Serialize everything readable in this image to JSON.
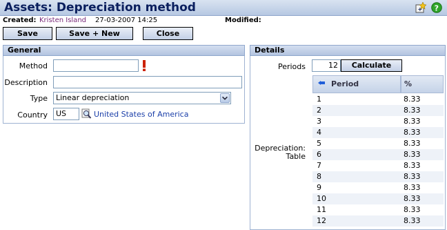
{
  "header": {
    "title": "Assets: Depreciation method"
  },
  "info": {
    "created_label": "Created:",
    "created_by": "Kristen Island",
    "created_at": "27-03-2007 14:25",
    "modified_label": "Modified:"
  },
  "toolbar": {
    "save": "Save",
    "save_new": "Save + New",
    "close": "Close"
  },
  "general": {
    "heading": "General",
    "method_label": "Method",
    "method_value": "",
    "description_label": "Description",
    "description_value": "",
    "type_label": "Type",
    "type_value": "Linear depreciation",
    "country_label": "Country",
    "country_value": "US",
    "country_name": "United States of America"
  },
  "details": {
    "heading": "Details",
    "periods_label": "Periods",
    "periods_value": "12",
    "calculate": "Calculate",
    "table_label_1": "Depreciation:",
    "table_label_2": "Table",
    "columns": [
      "Period",
      "%"
    ],
    "rows": [
      [
        "1",
        "8.33"
      ],
      [
        "2",
        "8.33"
      ],
      [
        "3",
        "8.33"
      ],
      [
        "4",
        "8.33"
      ],
      [
        "5",
        "8.33"
      ],
      [
        "6",
        "8.33"
      ],
      [
        "7",
        "8.33"
      ],
      [
        "8",
        "8.33"
      ],
      [
        "9",
        "8.33"
      ],
      [
        "10",
        "8.33"
      ],
      [
        "11",
        "8.33"
      ],
      [
        "12",
        "8.33"
      ]
    ]
  },
  "icons": [
    "add-favorite-icon",
    "help-icon",
    "required-icon",
    "search-icon",
    "dropdown-arrow-icon",
    "sort-icon"
  ],
  "colors": {
    "accent": "#b6c8e2",
    "title": "#0b1f5e",
    "link": "#1a3ea8",
    "required": "#cc2200"
  }
}
